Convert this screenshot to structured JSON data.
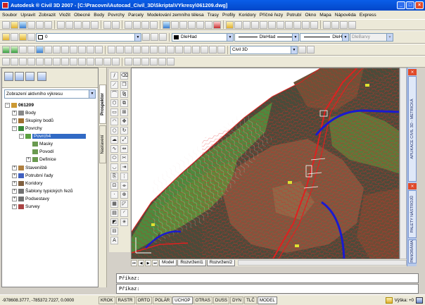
{
  "window": {
    "title": "Autodesk ® Civil 3D 2007 - [C:\\Pracovni\\Autocad_Civil_3D\\Skripta\\VYkresy\\061209.dwg]",
    "controls": [
      "_",
      "□",
      "×"
    ]
  },
  "menubar": {
    "items": [
      "Soubor",
      "Upravit",
      "Zobrazit",
      "Vložit",
      "Obecné",
      "Body",
      "Povrchy",
      "Parcely",
      "Modelování zemního tělesa",
      "Trasy",
      "Profily",
      "Koridory",
      "Příčné řezy",
      "Potrubí",
      "Okno",
      "Mapa",
      "Nápověda",
      "Express"
    ]
  },
  "toolbars": {
    "layer_combo": "0",
    "color_combo": "DleHlad",
    "linetype_combo": "DleHlad",
    "lineweight_combo": "DleHlad",
    "plotstyle_combo": "DleBarvy",
    "workspace_combo": "Civil 3D"
  },
  "prospector": {
    "view_dropdown": "Zobrazení aktivního výkresu",
    "tree": {
      "root": "061209",
      "items": [
        {
          "label": "Body",
          "level": 1
        },
        {
          "label": "Skupiny bodů",
          "level": 1
        },
        {
          "label": "Povrchy",
          "level": 1
        },
        {
          "label": "Povrch4",
          "level": 2
        },
        {
          "label": "Masky",
          "level": 3
        },
        {
          "label": "Povodí",
          "level": 3
        },
        {
          "label": "Definice",
          "level": 3
        },
        {
          "label": "Staveniště",
          "level": 1
        },
        {
          "label": "Potrubní řady",
          "level": 1
        },
        {
          "label": "Koridory",
          "level": 1
        },
        {
          "label": "Šablony typických řezů",
          "level": 1
        },
        {
          "label": "Podsestavy",
          "level": 1
        },
        {
          "label": "Survey",
          "level": 1
        }
      ]
    },
    "tabs": [
      "Prospektor",
      "Nastavení"
    ]
  },
  "drawing": {
    "layout_tabs": [
      "Model",
      "Rozvržení1",
      "Rozvržení2"
    ],
    "nav_buttons": [
      "⏮",
      "◀",
      "▶",
      "⏭"
    ]
  },
  "right_palettes": {
    "tabs": [
      "APLIKACE CIVIL 3D - METRICKÁ",
      "PALETY NÁSTROJŮ",
      "PANORÁMA"
    ],
    "close": "×"
  },
  "command": {
    "line1": "Příkaz:",
    "line2": "Příkaz:"
  },
  "statusbar": {
    "coords": "-978608.3777, -785372.7227, 0.0000",
    "toggles": [
      "KROK",
      "RASTR",
      "ORTO",
      "POLÁR",
      "UCHOP",
      "OTRAS",
      "DUSS",
      "DYN",
      "TLČ",
      "MODEL"
    ],
    "active_toggles": [
      "UCHOP",
      "MODEL"
    ],
    "vyska": "Výška: +0"
  },
  "colors": {
    "titlebar": "#0a5ee8",
    "surface_dark": "#4a4c3a",
    "surface_brown": "#7a5a40",
    "surface_green": "#4d8a3e",
    "contour": "#e02020",
    "alignment": "#1a1ad0"
  }
}
